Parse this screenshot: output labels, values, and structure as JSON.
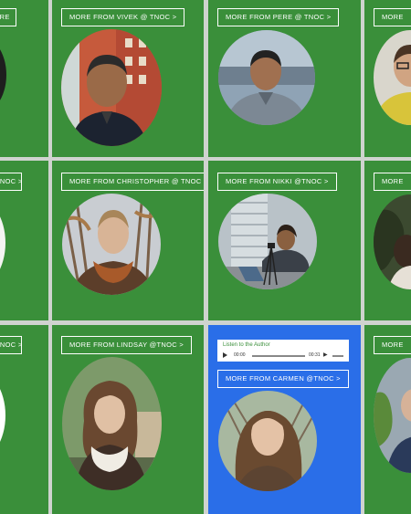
{
  "tiles": {
    "row1": {
      "partial_left": "MORE",
      "vivek": "MORE FROM VIVEK @ TNOC >",
      "pere": "MORE FROM PERE @ TNOC >",
      "partial_right": "MORE"
    },
    "row2": {
      "partial_left": "TNOC >",
      "christopher": "MORE FROM CHRISTOPHER @ TNOC >",
      "nikki": "MORE FROM NIKKI @TNOC >",
      "partial_right": "MORE"
    },
    "row3": {
      "partial_left": "TNOC >",
      "lindsay": "MORE FROM LINDSAY @TNOC >",
      "carmen": "MORE FROM CARMEN @TNOC >",
      "partial_right": "MORE"
    }
  },
  "audio_player": {
    "title": "Listen to the Author",
    "current_time": "00:00",
    "duration": "00:31",
    "volume_icon": "speaker-icon"
  },
  "colors": {
    "tile_green": "#3a8f3a",
    "tile_blue": "#2a6ee8",
    "divider": "#cfd3cf"
  }
}
